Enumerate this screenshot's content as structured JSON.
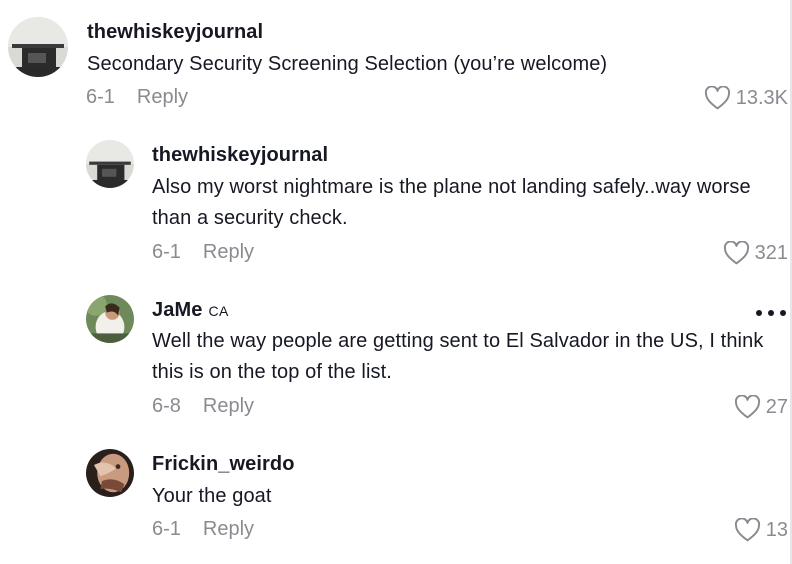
{
  "comments": [
    {
      "username": "thewhiskeyjournal",
      "region": "",
      "text": "Secondary Security Screening Selection (you’re welcome)",
      "date": "6-1",
      "reply_label": "Reply",
      "likes": "13.3K"
    },
    {
      "username": "thewhiskeyjournal",
      "region": "",
      "text": "Also my worst nightmare is the plane not landing safely..way worse than a security check.",
      "date": "6-1",
      "reply_label": "Reply",
      "likes": "321"
    },
    {
      "username": "JaMe",
      "region": "CA",
      "text": "Well the way people are getting sent to El Salvador in the US, I think this is on the top of the list.",
      "date": "6-8",
      "reply_label": "Reply",
      "likes": "27"
    },
    {
      "username": "Frickin_weirdo",
      "region": "",
      "text": "Your the goat",
      "date": "6-1",
      "reply_label": "Reply",
      "likes": "13"
    }
  ],
  "icons": {
    "like": "heart-outline-icon",
    "more": "more-options-icon"
  },
  "colors": {
    "text": "#161823",
    "meta": "#8a8b91"
  }
}
